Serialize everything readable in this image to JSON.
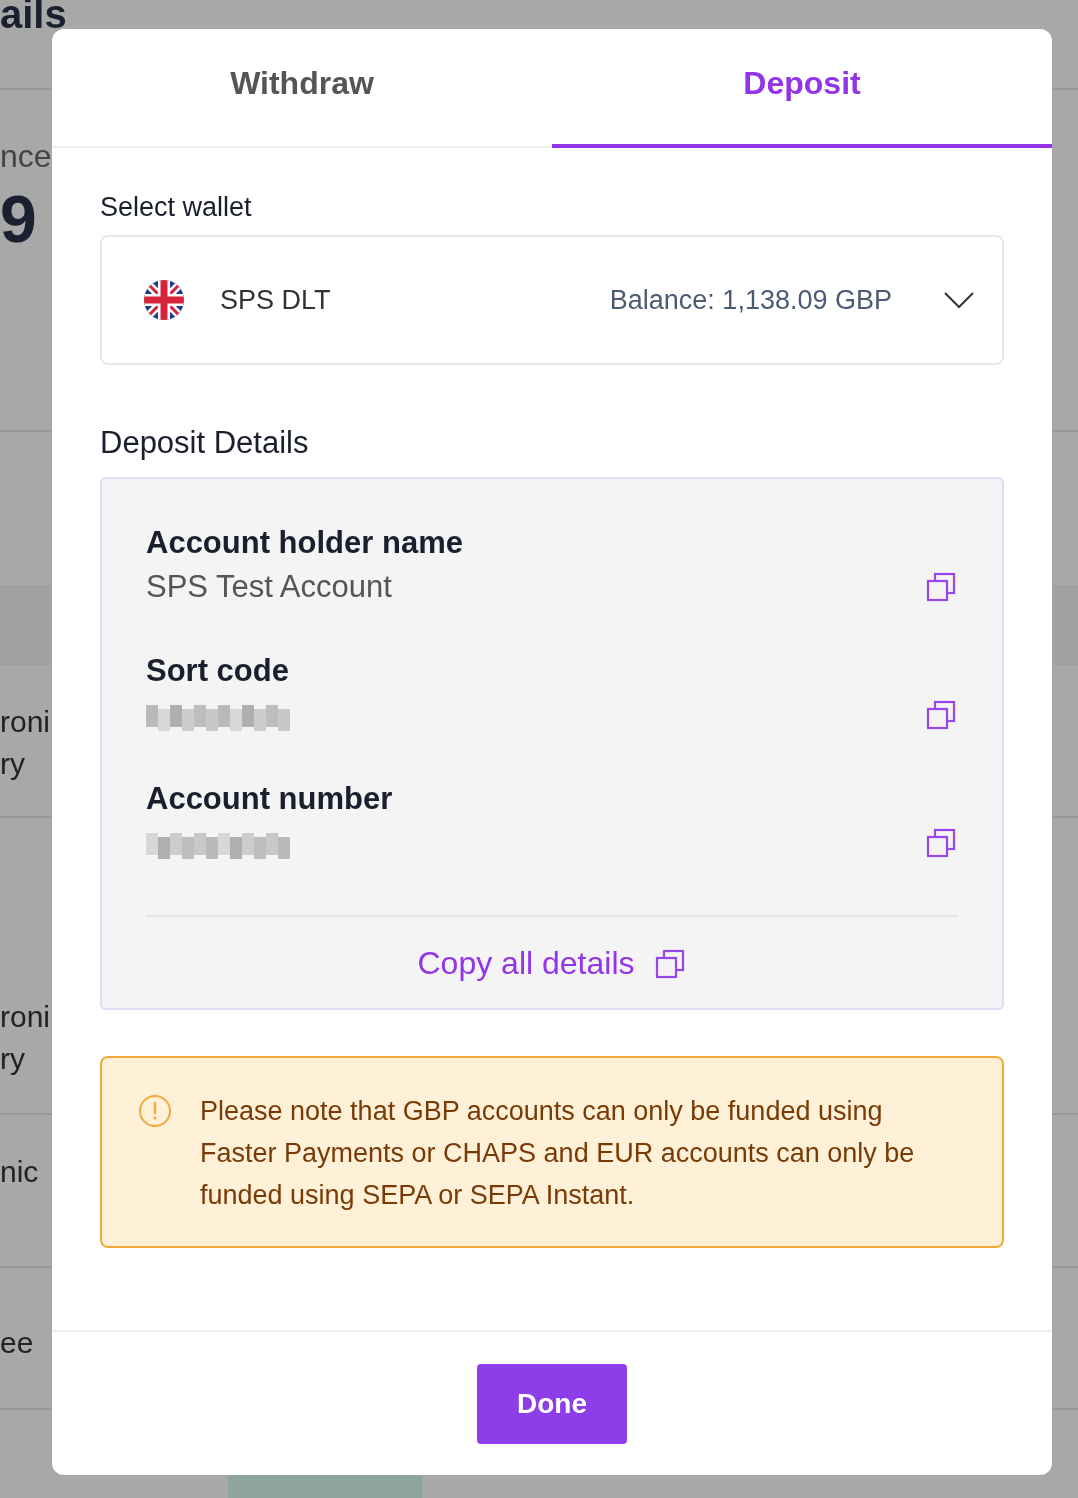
{
  "background": {
    "title": "ails",
    "balance_label": "nce",
    "balance_value": "9",
    "rows": [
      {
        "line_1": "roni",
        "line_2": "ry"
      },
      {
        "line_1": "roni",
        "line_2": "ry"
      },
      {
        "line_1": "nic"
      },
      {
        "line_1": "ee"
      }
    ],
    "amount_tag": true
  },
  "tabs": [
    {
      "label": "Withdraw",
      "selected": false
    },
    {
      "label": "Deposit",
      "selected": true
    }
  ],
  "wallet": {
    "label": "Select wallet",
    "name": "SPS DLT",
    "balance": "Balance: 1,138.09 GBP"
  },
  "details": {
    "title": "Deposit Details",
    "fields": [
      {
        "label": "Account holder name",
        "kind": "text",
        "value": "SPS Test Account"
      },
      {
        "label": "Sort code",
        "kind": "redacted"
      },
      {
        "label": "Account number",
        "kind": "redacted"
      }
    ],
    "copy_all": "Copy all details"
  },
  "notice": "Please note that GBP accounts can only be funded using Faster Payments or CHAPS and EUR accounts can only be funded using SEPA or SEPA Instant.",
  "done": "Done"
}
